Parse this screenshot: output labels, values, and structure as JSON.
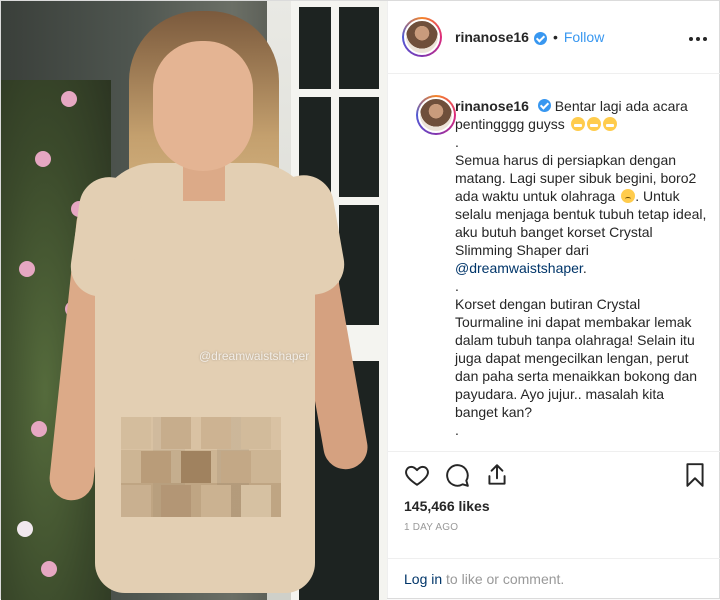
{
  "photo": {
    "watermark": "@dreamwaistshaper"
  },
  "header": {
    "username": "rinanose16",
    "separator": "•",
    "follow_label": "Follow",
    "more_icon": "more-horizontal-icon",
    "more_label": "• • •"
  },
  "caption": {
    "username": "rinanose16",
    "line1": "Bentar lagi ada acara pentingggg guyss",
    "dot1": ".",
    "para1a": "Semua harus di persiapkan dengan matang. Lagi super sibuk begini, boro2 ada waktu untuk olahraga",
    "para1b": ". Untuk selalu menjaga bentuk tubuh tetap ideal, aku butuh banget korset Crystal Slimming Shaper dari",
    "mention": "@dreamwaistshaper",
    "para1c": ".",
    "dot2": ".",
    "para2": "Korset dengan butiran Crystal Tourmaline ini dapat membakar lemak dalam tubuh tanpa olahraga! Selain itu juga dapat mengecilkan lengan, perut dan paha serta menaikkan bokong dan payudara. Ayo jujur.. masalah kita banget kan?",
    "dot3": "."
  },
  "actions": {
    "like_icon": "heart-icon",
    "comment_icon": "comment-icon",
    "share_icon": "share-icon",
    "save_icon": "bookmark-icon"
  },
  "likes": "145,466 likes",
  "time_ago": "1 DAY AGO",
  "login": {
    "link": "Log in",
    "rest": "to like or comment."
  },
  "colors": {
    "accent_blue": "#3897f0",
    "text": "#262626",
    "muted": "#999999",
    "link_dark": "#003569",
    "border": "#efefef"
  }
}
